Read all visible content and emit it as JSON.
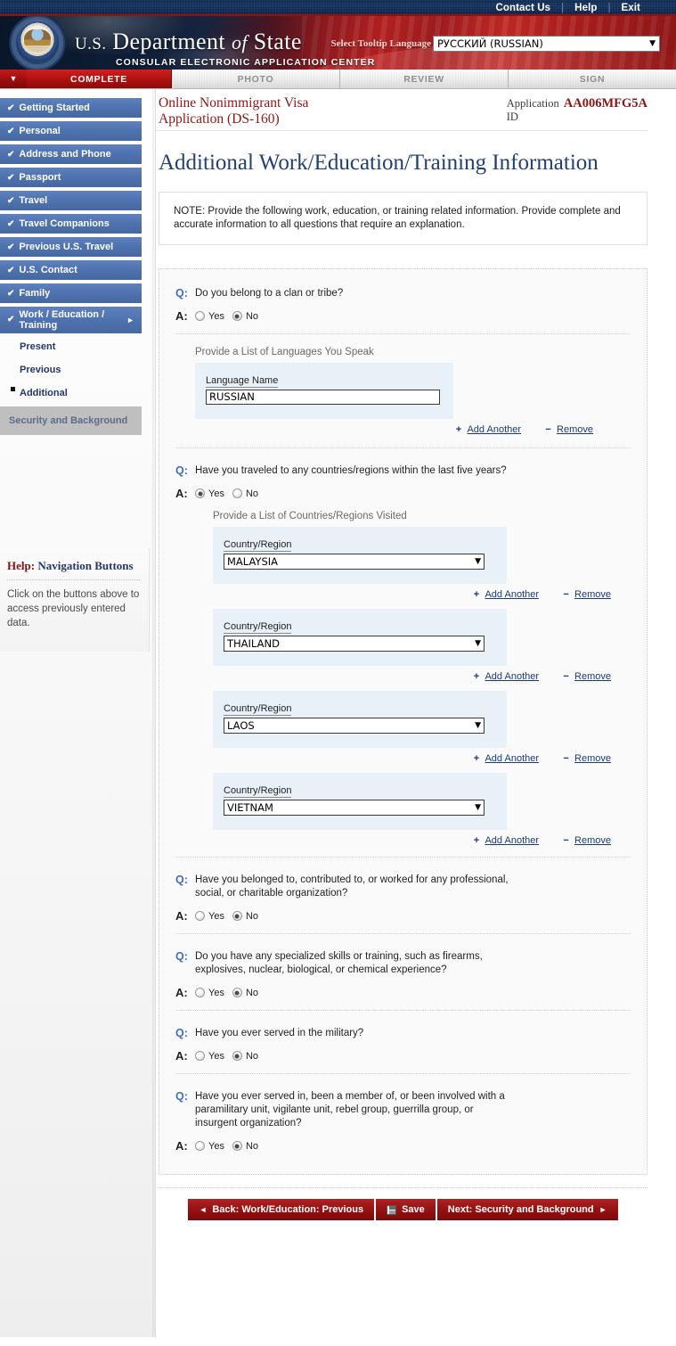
{
  "utility": {
    "links": [
      {
        "label": "Contact Us"
      },
      {
        "label": "Help"
      },
      {
        "label": "Exit"
      }
    ],
    "separator": "|"
  },
  "banner": {
    "title_us": "U.S.",
    "title_department": "Department",
    "title_of": "of",
    "title_state": "State",
    "subtitle": "CONSULAR ELECTRONIC APPLICATION CENTER",
    "tooltip_language_label": "Select Tooltip Language",
    "tooltip_language_value": "РУССКИЙ (RUSSIAN)",
    "seal_name": "department-of-state-seal"
  },
  "stage_tabs": [
    {
      "label": "COMPLETE",
      "active": true
    },
    {
      "label": "PHOTO",
      "active": false
    },
    {
      "label": "REVIEW",
      "active": false
    },
    {
      "label": "SIGN",
      "active": false
    }
  ],
  "sidebar": {
    "items": [
      {
        "label": "Getting Started",
        "complete": true
      },
      {
        "label": "Personal",
        "complete": true
      },
      {
        "label": "Address and Phone",
        "complete": true
      },
      {
        "label": "Passport",
        "complete": true
      },
      {
        "label": "Travel",
        "complete": true
      },
      {
        "label": "Travel Companions",
        "complete": true
      },
      {
        "label": "Previous U.S. Travel",
        "complete": true
      },
      {
        "label": "U.S. Contact",
        "complete": true
      },
      {
        "label": "Family",
        "complete": true
      },
      {
        "label": "Work / Education / Training",
        "complete": true,
        "expanded": true
      }
    ],
    "subitems": [
      {
        "label": "Present",
        "current": false
      },
      {
        "label": "Previous",
        "current": false
      },
      {
        "label": "Additional",
        "current": true
      }
    ],
    "disabled_item": {
      "label": "Security and Background"
    },
    "check_glyph": "✔",
    "arrow_glyph": "►"
  },
  "help": {
    "title_prefix": "Help:",
    "title_text": "Navigation Buttons",
    "body": "Click on the buttons above to access previously entered data."
  },
  "header": {
    "app_title": "Online Nonimmigrant Visa Application (DS-160)",
    "app_id_label": "Application ID",
    "app_id_value": "AA006MFG5A"
  },
  "main": {
    "page_title": "Additional Work/Education/Training Information",
    "note": "NOTE: Provide the following work, education, or training related information. Provide complete and accurate information to all questions that require an explanation.",
    "q_mark": "Q:",
    "a_mark": "A:",
    "yes_label": "Yes",
    "no_label": "No",
    "add_another_label": "Add Another",
    "remove_label": "Remove",
    "add_glyph": "+",
    "remove_glyph": "−",
    "caret_glyph": "▼"
  },
  "questions": [
    {
      "id": "clan-or-tribe",
      "text": "Do you belong to a clan or tribe?",
      "answer": "No"
    },
    {
      "id": "traveled-countries",
      "text": "Have you traveled to any countries/regions within the last five years?",
      "answer": "Yes"
    },
    {
      "id": "professional-organization",
      "text": "Have you belonged to, contributed to, or worked for any professional, social, or charitable organization?",
      "answer": "No"
    },
    {
      "id": "specialized-skills",
      "text": "Do you have any specialized skills or training, such as firearms, explosives, nuclear, biological, or chemical experience?",
      "answer": "No"
    },
    {
      "id": "served-in-military",
      "text": "Have you ever served in the military?",
      "answer": "No"
    },
    {
      "id": "paramilitary-unit",
      "text": "Have you ever served in, been a member of, or been involved with a paramilitary unit, vigilante unit, rebel group, guerrilla group, or insurgent organization?",
      "answer": "No"
    }
  ],
  "languages": {
    "section_label": "Provide a List of Languages You Speak",
    "field_label": "Language Name",
    "entries": [
      {
        "value": "RUSSIAN"
      }
    ]
  },
  "countries": {
    "section_label": "Provide a List of Countries/Regions Visited",
    "field_label": "Country/Region",
    "entries": [
      {
        "value": "MALAYSIA"
      },
      {
        "value": "THAILAND"
      },
      {
        "value": "LAOS"
      },
      {
        "value": "VIETNAM"
      }
    ]
  },
  "footer": {
    "back_label": "Back: Work/Education: Previous",
    "save_label": "Save",
    "next_label": "Next: Security and Background",
    "back_glyph": "◄",
    "next_glyph": "►"
  }
}
